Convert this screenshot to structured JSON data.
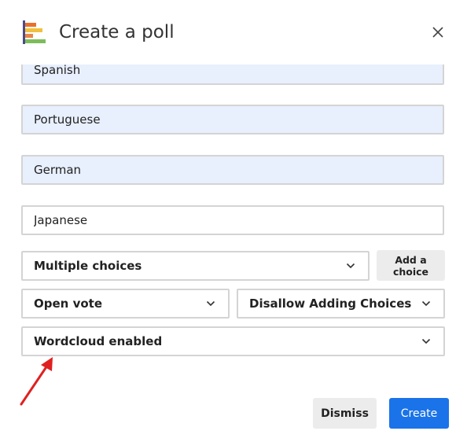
{
  "dialog": {
    "title": "Create a poll",
    "app_icon": "poll-bars-icon",
    "close_icon": "close-icon"
  },
  "choices": [
    {
      "value": "Spanish",
      "placeholder": ""
    },
    {
      "value": "Portuguese",
      "placeholder": ""
    },
    {
      "value": "German",
      "placeholder": ""
    },
    {
      "value": "Japanese",
      "placeholder": ""
    }
  ],
  "options": {
    "choice_mode": "Multiple choices",
    "vote_mode": "Open vote",
    "adding_mode": "Disallow Adding Choices",
    "wordcloud": "Wordcloud enabled"
  },
  "buttons": {
    "add_choice": "Add a choice",
    "dismiss": "Dismiss",
    "create": "Create"
  },
  "colors": {
    "primary": "#1a73e8",
    "autofill_bg": "#e8effd",
    "annotation_arrow": "#e02020",
    "icon_bar_1": "#4a4a8a",
    "icon_bar_2": "#e8702a",
    "icon_bar_3": "#f0c040",
    "icon_bar_4": "#7cbd5a"
  }
}
